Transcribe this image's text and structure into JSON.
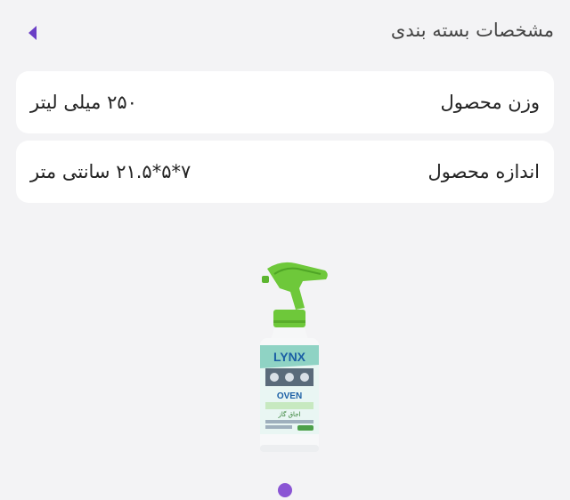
{
  "header": {
    "title": "مشخصات بسته بندی",
    "back_icon": "chevron-left-icon",
    "accent_color": "#6b3fc6"
  },
  "specs": [
    {
      "label": "وزن محصول",
      "value": "۲۵۰ میلی لیتر"
    },
    {
      "label": "اندازه محصول",
      "value": "۷*۵*۲۱.۵ سانتی متر"
    }
  ],
  "product_image": {
    "brand": "LYNX",
    "product_name": "OVEN",
    "subtitle_fa": "اجاق گاز"
  },
  "carousel": {
    "active_color": "#8a55d4"
  }
}
